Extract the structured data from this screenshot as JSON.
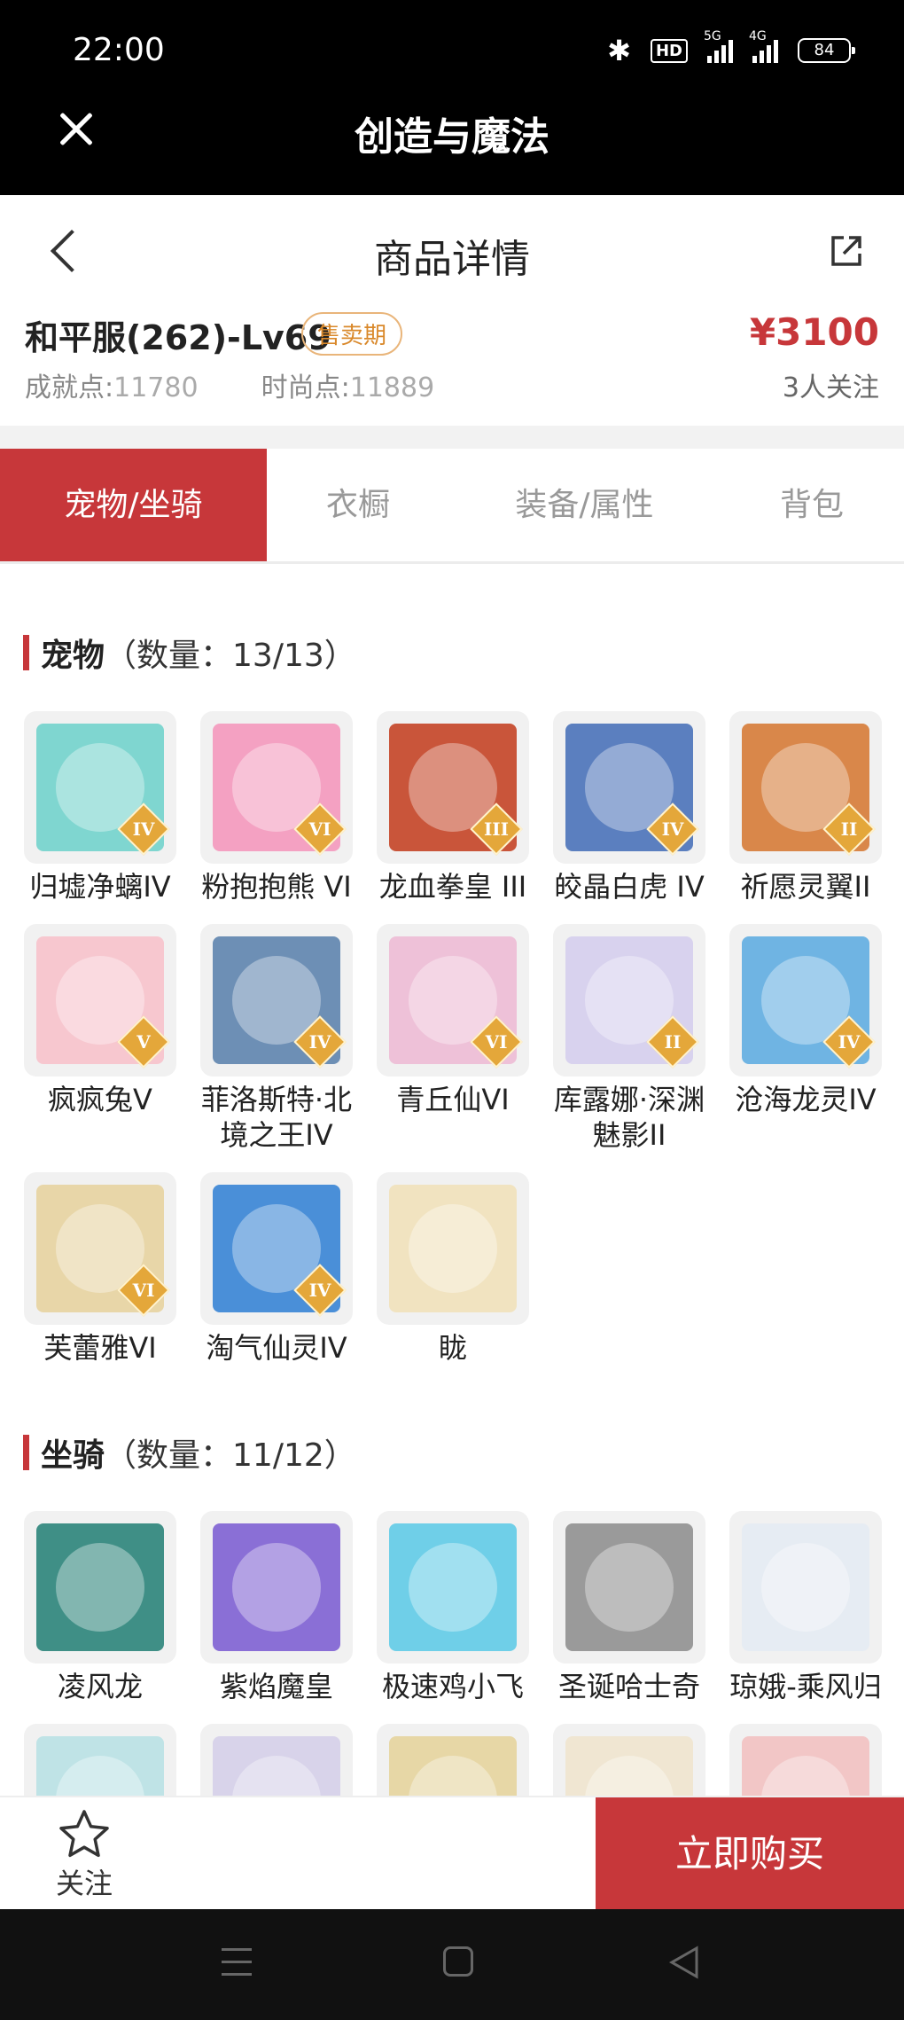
{
  "status_bar": {
    "time": "22:00",
    "hd": "HD",
    "net1": "5G",
    "net2": "4G",
    "battery": "84"
  },
  "app": {
    "title": "创造与魔法"
  },
  "header": {
    "title": "商品详情"
  },
  "product": {
    "name": "和平服(262)-Lv69",
    "badge": "售卖期",
    "price": "¥3100",
    "achievement_label": "成就点:",
    "achievement_value": "11780",
    "fashion_label": "时尚点:",
    "fashion_value": "11889",
    "followers": "3人关注"
  },
  "tabs": [
    {
      "label": "宠物/坐骑"
    },
    {
      "label": "衣橱"
    },
    {
      "label": "装备/属性"
    },
    {
      "label": "背包"
    }
  ],
  "pets": {
    "title": "宠物",
    "count": "（数量：13/13）",
    "items": [
      {
        "name": "归墟净螭IV",
        "rank": "IV",
        "color": "#7fd6d0"
      },
      {
        "name": "粉抱抱熊 VI",
        "rank": "VI",
        "color": "#f4a1c2"
      },
      {
        "name": "龙血拳皇 III",
        "rank": "III",
        "color": "#c9553a"
      },
      {
        "name": "皎晶白虎 IV",
        "rank": "IV",
        "color": "#5b7fbf"
      },
      {
        "name": "祈愿灵翼II",
        "rank": "II",
        "color": "#d9874a"
      },
      {
        "name": "疯疯兔V",
        "rank": "V",
        "color": "#f7c7cf"
      },
      {
        "name": "菲洛斯特·北境之王IV",
        "rank": "IV",
        "color": "#6d8fb5"
      },
      {
        "name": "青丘仙VI",
        "rank": "VI",
        "color": "#eec1d8"
      },
      {
        "name": "库露娜·深渊魅影II",
        "rank": "II",
        "color": "#d8d2ee"
      },
      {
        "name": "沧海龙灵IV",
        "rank": "IV",
        "color": "#6fb4e3"
      },
      {
        "name": "芙蕾雅VI",
        "rank": "VI",
        "color": "#e8d6a8"
      },
      {
        "name": "淘气仙灵IV",
        "rank": "IV",
        "color": "#4a8fd8"
      },
      {
        "name": "眬",
        "rank": "",
        "color": "#f1e3c0"
      }
    ]
  },
  "mounts": {
    "title": "坐骑",
    "count": "（数量：11/12）",
    "items": [
      {
        "name": "凌风龙",
        "color": "#3f8f86"
      },
      {
        "name": "紫焰魔皇",
        "color": "#8a6fd6"
      },
      {
        "name": "极速鸡小飞",
        "color": "#6fcfe8"
      },
      {
        "name": "圣诞哈士奇",
        "color": "#9a9a9a"
      },
      {
        "name": "琼娥-乘风归",
        "color": "#e6ecf3"
      },
      {
        "name": "",
        "color": "#bfe3e6"
      },
      {
        "name": "",
        "color": "#d8d3ea"
      },
      {
        "name": "",
        "color": "#e7d7a6"
      },
      {
        "name": "",
        "color": "#f0e6d2"
      },
      {
        "name": "",
        "color": "#f2c6c6"
      }
    ]
  },
  "bottom": {
    "follow_label": "关注",
    "buy_label": "立即购买"
  },
  "colors": {
    "accent": "#c7373a",
    "badge": "#d9882a"
  }
}
